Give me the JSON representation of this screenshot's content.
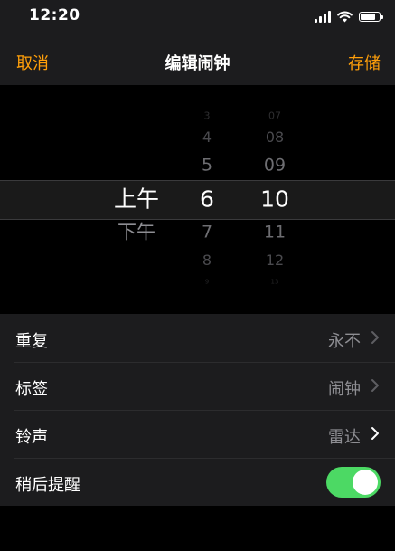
{
  "status_bar": {
    "time": "12:20",
    "battery_level": 0.9
  },
  "nav": {
    "cancel_label": "取消",
    "title": "编辑闹钟",
    "save_label": "存储"
  },
  "picker": {
    "period": {
      "selected": "上午",
      "next": "下午"
    },
    "hours": {
      "above": [
        "3",
        "4",
        "5"
      ],
      "selected": "6",
      "below": [
        "7",
        "8",
        "9"
      ]
    },
    "minutes": {
      "above": [
        "07",
        "08",
        "09"
      ],
      "selected": "10",
      "below": [
        "11",
        "12",
        "13"
      ]
    }
  },
  "settings": {
    "repeat": {
      "label": "重复",
      "value": "永不"
    },
    "tag": {
      "label": "标签",
      "value": "闹钟"
    },
    "sound": {
      "label": "铃声",
      "value": "雷达"
    },
    "snooze": {
      "label": "稍后提醒",
      "enabled": true
    }
  },
  "colors": {
    "accent": "#ff9f0a",
    "toggle_on": "#4cd964",
    "secondary_text": "#8e8e93",
    "panel": "#1c1c1e"
  }
}
